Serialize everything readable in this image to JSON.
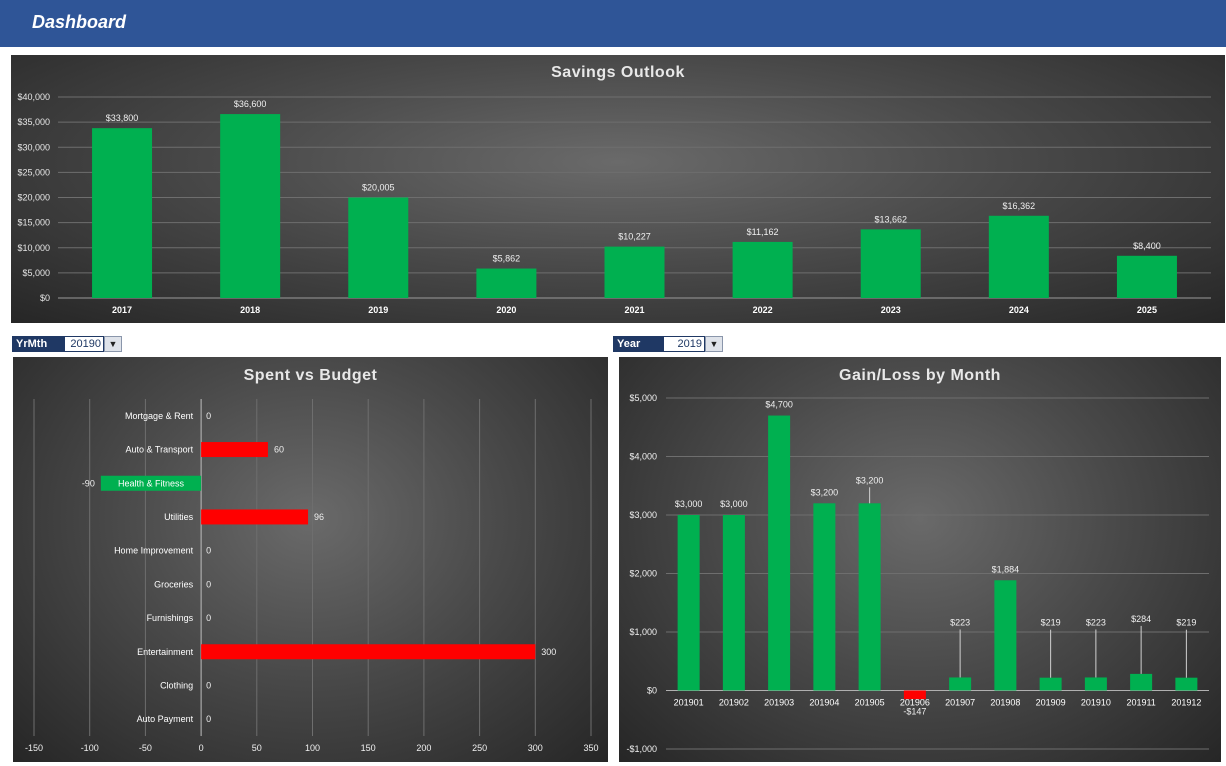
{
  "header": {
    "title": "Dashboard"
  },
  "filters": {
    "yrmth": {
      "label": "YrMth",
      "value": "20190"
    },
    "year": {
      "label": "Year",
      "value": "2019"
    }
  },
  "icons": {
    "filter": "filter-icon"
  },
  "colors": {
    "positive": "#00b050",
    "negative": "#ff0000",
    "header": "#2f5597",
    "filter_label": "#1f3864"
  },
  "chart_data": [
    {
      "id": "savings",
      "type": "bar",
      "title": "Savings Outlook",
      "categories": [
        "2017",
        "2018",
        "2019",
        "2020",
        "2021",
        "2022",
        "2023",
        "2024",
        "2025"
      ],
      "values": [
        33800,
        36600,
        20005,
        5862,
        10227,
        11162,
        13662,
        16362,
        8400
      ],
      "data_labels": [
        "$33,800",
        "$36,600",
        "$20,005",
        "$5,862",
        "$10,227",
        "$11,162",
        "$13,662",
        "$16,362",
        "$8,400"
      ],
      "ylim": [
        0,
        40000
      ],
      "yticks": [
        0,
        5000,
        10000,
        15000,
        20000,
        25000,
        30000,
        35000,
        40000
      ],
      "ytick_labels": [
        "$0",
        "$5,000",
        "$10,000",
        "$15,000",
        "$20,000",
        "$25,000",
        "$30,000",
        "$35,000",
        "$40,000"
      ],
      "grid": true,
      "legend": "none"
    },
    {
      "id": "spent",
      "type": "bar",
      "orientation": "horizontal",
      "title": "Spent vs Budget",
      "categories": [
        "Mortgage & Rent",
        "Auto & Transport",
        "Health & Fitness",
        "Utilities",
        "Home Improvement",
        "Groceries",
        "Furnishings",
        "Entertainment",
        "Clothing",
        "Auto Payment"
      ],
      "values": [
        0,
        60,
        -90,
        96,
        0,
        0,
        0,
        300,
        0,
        0
      ],
      "data_labels": [
        "0",
        "60",
        "-90",
        "96",
        "0",
        "0",
        "0",
        "300",
        "0",
        "0"
      ],
      "xlim": [
        -150,
        350
      ],
      "xticks": [
        -150,
        -100,
        -50,
        0,
        50,
        100,
        150,
        200,
        250,
        300,
        350
      ],
      "xtick_labels": [
        "-150",
        "-100",
        "-50",
        "0",
        "50",
        "100",
        "150",
        "200",
        "250",
        "300",
        "350"
      ],
      "grid": true,
      "legend": "none"
    },
    {
      "id": "gain",
      "type": "bar",
      "title": "Gain/Loss by Month",
      "categories": [
        "201901",
        "201902",
        "201903",
        "201904",
        "201905",
        "201906",
        "201907",
        "201908",
        "201909",
        "201910",
        "201911",
        "201912"
      ],
      "values": [
        3000,
        3000,
        4700,
        3200,
        3200,
        -147,
        223,
        1884,
        219,
        223,
        284,
        219
      ],
      "data_labels": [
        "$3,000",
        "$3,000",
        "$4,700",
        "$3,200",
        "$3,200",
        "-$147",
        "$223",
        "$1,884",
        "$219",
        "$223",
        "$284",
        "$219"
      ],
      "ylim": [
        -1000,
        5000
      ],
      "yticks": [
        -1000,
        0,
        1000,
        2000,
        3000,
        4000,
        5000
      ],
      "ytick_labels": [
        "-$1,000",
        "$0",
        "$1,000",
        "$2,000",
        "$3,000",
        "$4,000",
        "$5,000"
      ],
      "grid": true,
      "legend": "none"
    }
  ]
}
